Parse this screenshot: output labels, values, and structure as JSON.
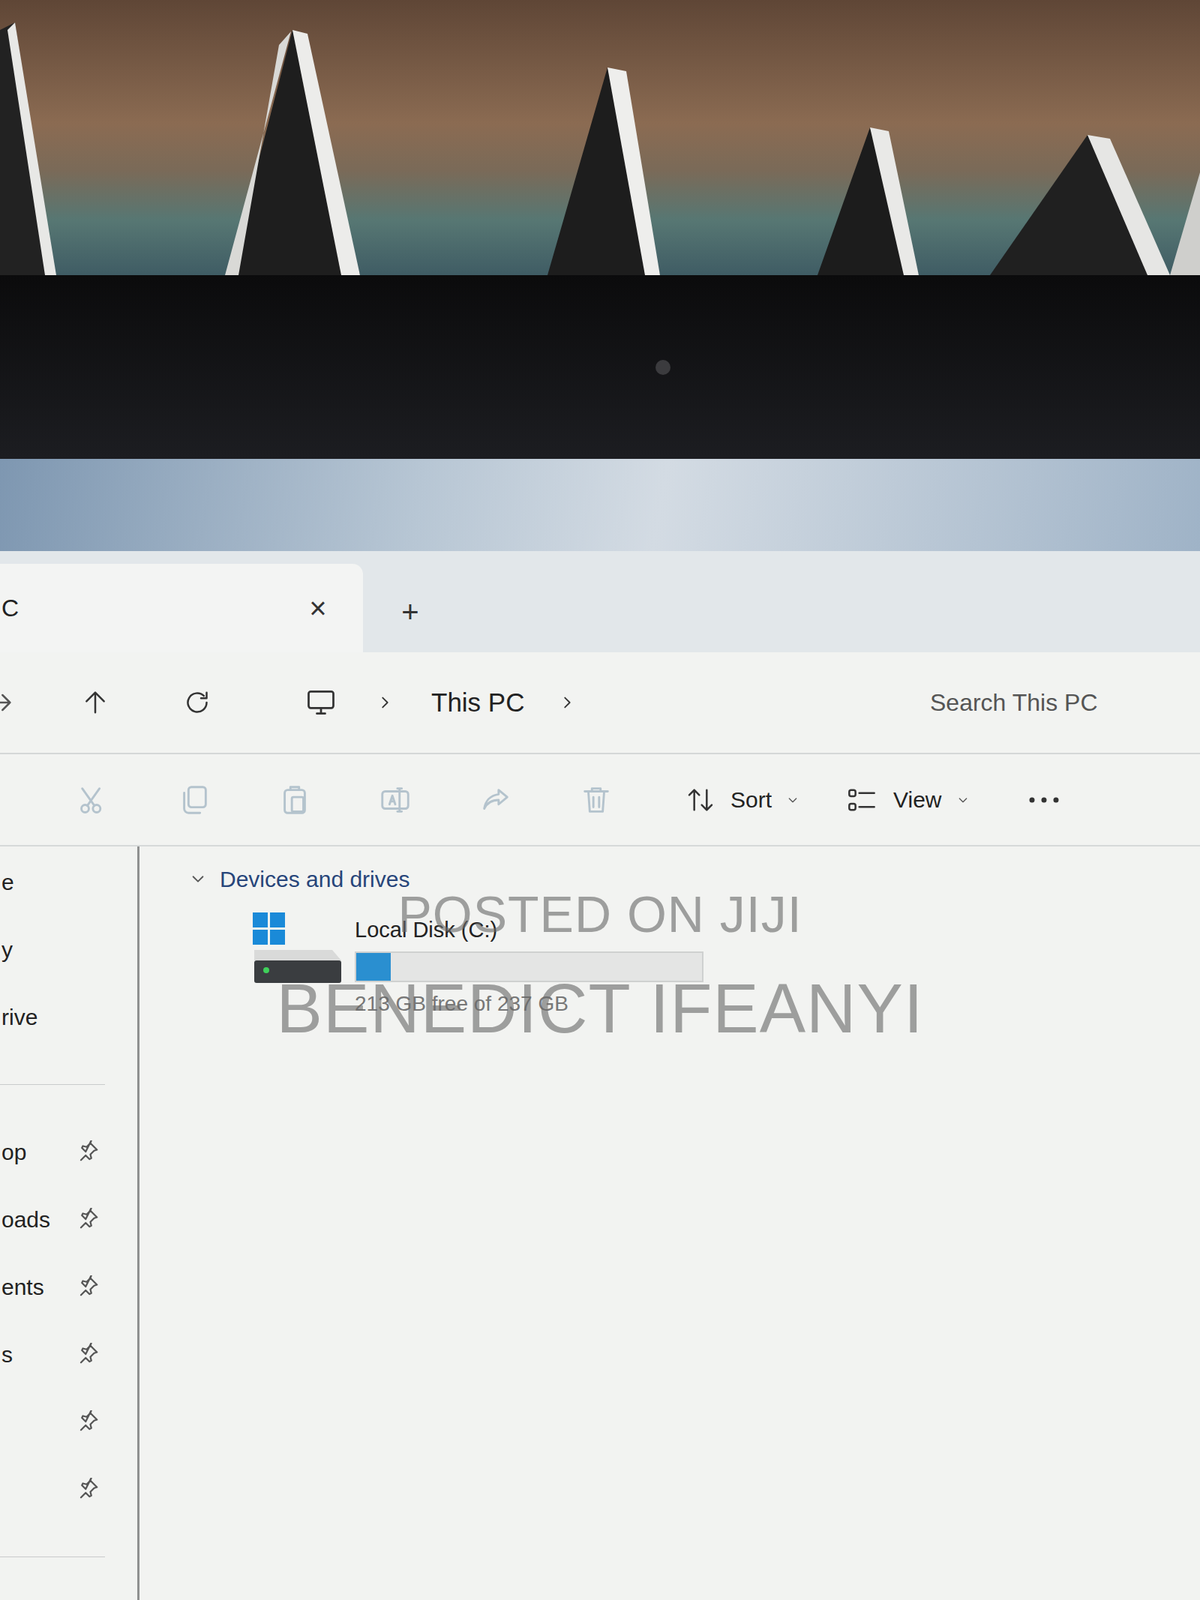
{
  "window": {
    "tab_title": "C",
    "close_glyph": "×",
    "new_tab_glyph": "+"
  },
  "address_bar": {
    "path": [
      "This PC"
    ],
    "search": {
      "placeholder": "Search This PC"
    }
  },
  "toolbar": {
    "actions": [
      {
        "disabled": true
      },
      {
        "disabled": true
      },
      {
        "disabled": true
      },
      {
        "disabled": true
      },
      {
        "disabled": true
      },
      {
        "disabled": true
      }
    ],
    "sort": "Sort",
    "view": "View"
  },
  "sidebar": {
    "items": [
      {
        "label": "e",
        "pinned": false
      },
      {
        "label": "y",
        "pinned": false
      },
      {
        "label": "rive",
        "pinned": false
      },
      {
        "label": "op",
        "pinned": true
      },
      {
        "label": "oads",
        "pinned": true
      },
      {
        "label": "ents",
        "pinned": true
      },
      {
        "label": "s",
        "pinned": true
      },
      {
        "label": "",
        "pinned": true
      },
      {
        "label": "",
        "pinned": true
      }
    ]
  },
  "content": {
    "groups": [
      {
        "label": "Devices and drives",
        "expanded": true,
        "drives": [
          {
            "name": "Local Disk (C:)",
            "level": 0.1,
            "free_text": "213 GB free of 237 GB"
          }
        ]
      }
    ]
  },
  "watermark": {
    "lines": [
      "POSTED ON JIJI",
      "BENEDICT IFEANYI"
    ]
  }
}
